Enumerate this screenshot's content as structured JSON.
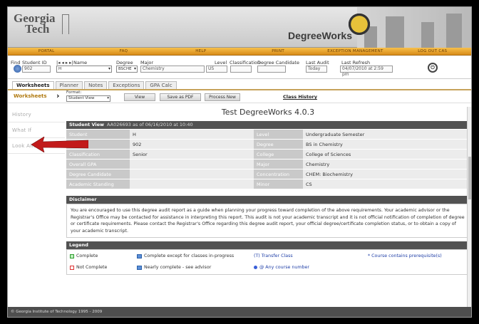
{
  "header": {
    "logo_line1": "Georgia",
    "logo_line2": "Tech",
    "app_title": "DegreeWorks"
  },
  "nav": [
    "PORTAL",
    "FAQ",
    "HELP",
    "PRINT",
    "EXCEPTION MANAGEMENT",
    "LOG OUT CAS"
  ],
  "student_info": {
    "find_label": "Find",
    "student_id_label": "Student ID",
    "student_id_value": "902",
    "name_label": "Name",
    "name_value": "H",
    "name_nav": "|◂ ◂  ▸ ▸|",
    "degree_label": "Degree",
    "degree_value": "BSCHE",
    "major_label": "Major",
    "major_value": "Chemistry",
    "level_label": "Level",
    "level_value": "US",
    "classification_label": "Classification",
    "degree_candidate_label": "Degree Candidate",
    "last_audit_label": "Last Audit",
    "last_audit_value": "Today",
    "last_refresh_label": "Last Refresh",
    "last_refresh_value": "04/07/2010 at 2:59 pm"
  },
  "tabs": [
    "Worksheets",
    "Planner",
    "Notes",
    "Exceptions",
    "GPA Calc"
  ],
  "worksheet_bar": {
    "label": "Worksheets",
    "format_label": "Format:",
    "format_value": "Student View",
    "view_btn": "View",
    "pdf_btn": "Save as PDF",
    "process_btn": "Process New",
    "class_history": "Class History"
  },
  "sidebar": [
    "History",
    "What If",
    "Look Ahead"
  ],
  "main": {
    "title": "Test DegreeWorks 4.0.3",
    "student_view_title": "Student View",
    "student_view_sub": "AA026693 as of 06/16/2010 at 10:40",
    "rows": [
      {
        "k": "Student",
        "v": "H",
        "k2": "Level",
        "v2": "Undergraduate Semester"
      },
      {
        "k": "ID",
        "v": "902",
        "k2": "Degree",
        "v2": "BS in Chemistry"
      },
      {
        "k": "Classification",
        "v": "Senior",
        "k2": "College",
        "v2": "College of Sciences"
      },
      {
        "k": "Overall GPA",
        "v": "",
        "k2": "Major",
        "v2": "Chemistry"
      },
      {
        "k": "Degree Candidate",
        "v": "",
        "k2": "Concentration",
        "v2": "CHEM: Biochemistry"
      },
      {
        "k": "Academic Standing",
        "v": "",
        "k2": "Minor",
        "v2": "CS"
      }
    ],
    "disclaimer_title": "Disclaimer",
    "disclaimer_text": "You are encouraged to use this degree audit report as a guide when planning your progress toward completion of the above requirements. Your academic advisor or the Registrar's Office may be contacted for assistance in interpreting this report. This audit is not your academic transcript and it is not official notification of completion of degree or certificate requirements. Please contact the Registrar's Office regarding this degree audit report, your official degree/certificate completion status, or to obtain a copy of your academic transcript.",
    "legend_title": "Legend",
    "legend": {
      "complete": "Complete",
      "not_complete": "Not Complete",
      "except_ip": "Complete except for classes in-progress",
      "nearly": "Nearly complete - see advisor",
      "transfer": "(T) Transfer Class",
      "any_course": "@ Any course number",
      "prereq": "* Course contains prerequisite(s)"
    }
  },
  "footer": "© Georgia Institute of Technology 1995 - 2009"
}
